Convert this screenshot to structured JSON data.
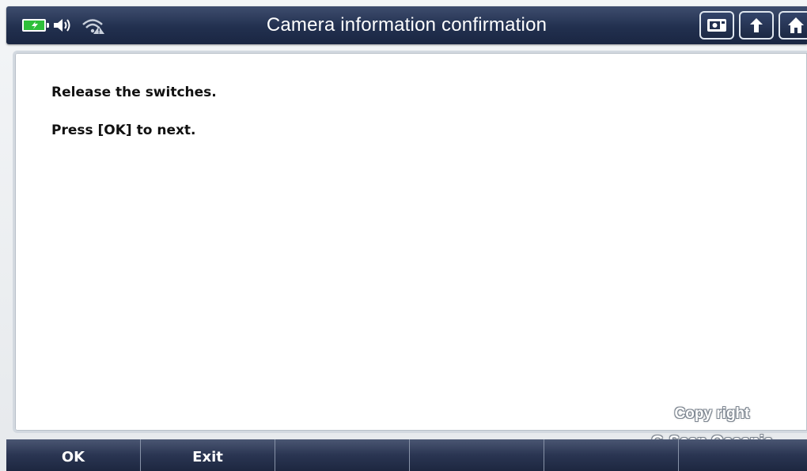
{
  "header": {
    "title": "Camera information confirmation",
    "status_icons": [
      "battery-charging-icon",
      "speaker-icon",
      "wifi-warning-icon"
    ],
    "buttons": [
      "screen-capture-icon",
      "back-arrow-icon",
      "home-icon"
    ]
  },
  "content": {
    "line1": "Release the switches.",
    "line2": "Press [OK] to next."
  },
  "watermark": {
    "line1": "Copy right",
    "line2": "G-Scan Oceania"
  },
  "function_bar": {
    "ok_label": "OK",
    "exit_label": "Exit",
    "f3_label": "",
    "f4_label": "",
    "f5_label": "",
    "f6_label": ""
  },
  "colors": {
    "title_bar": "#22304f",
    "battery": "#2fbf3a",
    "panel": "#ffffff",
    "text": "#111111"
  }
}
